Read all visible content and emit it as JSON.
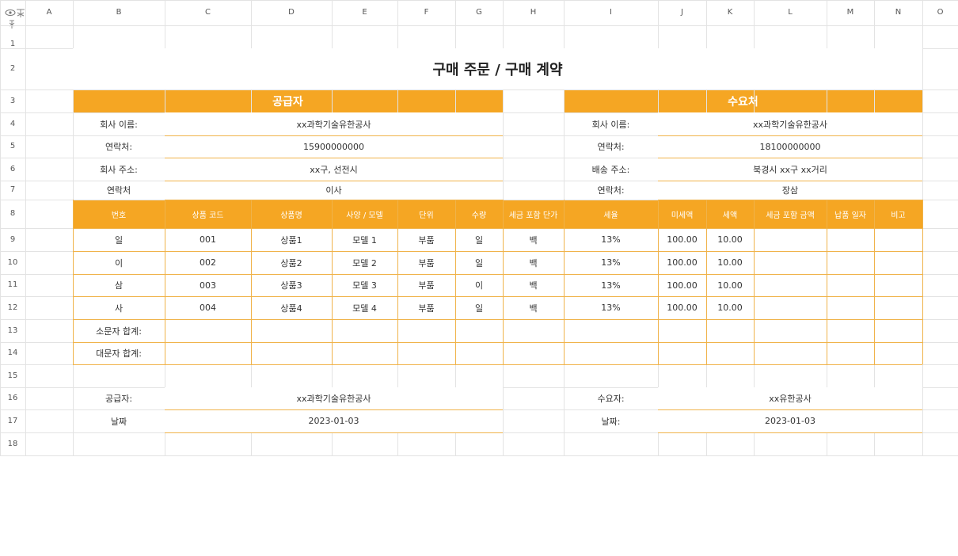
{
  "columns": [
    "A",
    "B",
    "C",
    "D",
    "E",
    "F",
    "G",
    "H",
    "I",
    "J",
    "K",
    "L",
    "M",
    "N",
    "O"
  ],
  "rows": [
    "1",
    "2",
    "3",
    "4",
    "5",
    "6",
    "7",
    "8",
    "9",
    "10",
    "11",
    "12",
    "13",
    "14",
    "15",
    "16",
    "17",
    "18"
  ],
  "title": "구매 주문 / 구매 계약",
  "supplier_header": "공급자",
  "buyer_header": "수요처",
  "supplier": {
    "company_label": "회사 이름:",
    "company": "xx과학기술유한공사",
    "contact_label": "연락처:",
    "contact": "15900000000",
    "address_label": "회사 주소:",
    "address": "xx구, 선전시",
    "person_label": "연락처",
    "person": "이사"
  },
  "buyer": {
    "company_label": "회사 이름:",
    "company": "xx과학기술유한공사",
    "contact_label": "연락처:",
    "contact": "18100000000",
    "address_label": "배송 주소:",
    "address": "북경시 xx구 xx거리",
    "person_label": "연락처:",
    "person": "장삼"
  },
  "table_headers": [
    "번호",
    "상품 코드",
    "상품명",
    "사양 / 모델",
    "단위",
    "수량",
    "세금 포함 단가",
    "세율",
    "미세액",
    "세액",
    "세금 포함 금액",
    "납품 일자",
    "비고"
  ],
  "items": [
    [
      "일",
      "001",
      "상품1",
      "모델 1",
      "부품",
      "일",
      "백",
      "13%",
      "100.00",
      "10.00",
      "",
      "",
      ""
    ],
    [
      "이",
      "002",
      "상품2",
      "모델 2",
      "부품",
      "일",
      "백",
      "13%",
      "100.00",
      "10.00",
      "",
      "",
      ""
    ],
    [
      "삼",
      "003",
      "상품3",
      "모델 3",
      "부품",
      "이",
      "백",
      "13%",
      "100.00",
      "10.00",
      "",
      "",
      ""
    ],
    [
      "사",
      "004",
      "상품4",
      "모델 4",
      "부품",
      "일",
      "백",
      "13%",
      "100.00",
      "10.00",
      "",
      "",
      ""
    ]
  ],
  "subtotal_label": "소문자 합계:",
  "total_label": "대문자 합계:",
  "footer": {
    "supplier_label": "공급자:",
    "supplier_value": "xx과학기술유한공사",
    "supplier_date_label": "날짜",
    "supplier_date": "2023-01-03",
    "buyer_label": "수요자:",
    "buyer_value": "xx유한공사",
    "buyer_date_label": "날짜:",
    "buyer_date": "2023-01-03"
  },
  "colors": {
    "accent": "#f5a623",
    "grid": "#e3e3e3"
  },
  "icons": [
    "eye-icon",
    "freeze-icon"
  ]
}
